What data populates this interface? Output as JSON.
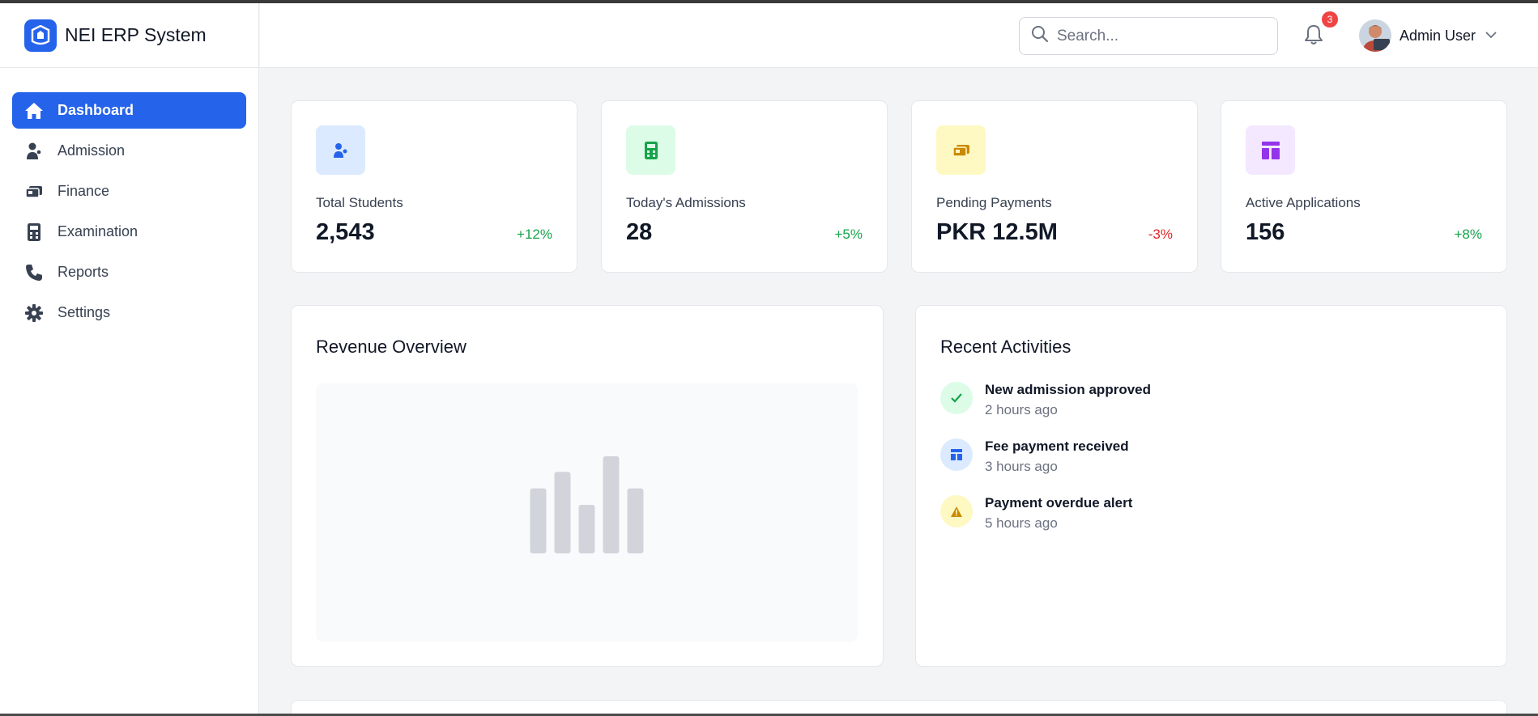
{
  "app": {
    "title": "NEI ERP System"
  },
  "sidebar": {
    "items": [
      {
        "label": "Dashboard",
        "icon": "home-icon",
        "active": true
      },
      {
        "label": "Admission",
        "icon": "user-tie-icon"
      },
      {
        "label": "Finance",
        "icon": "money-bill-icon"
      },
      {
        "label": "Examination",
        "icon": "calculator-icon"
      },
      {
        "label": "Reports",
        "icon": "phone-icon"
      },
      {
        "label": "Settings",
        "icon": "gear-icon"
      }
    ]
  },
  "header": {
    "search_placeholder": "Search...",
    "notification_count": "3",
    "user_name": "Admin User"
  },
  "stats": [
    {
      "label": "Total Students",
      "value": "2,543",
      "change": "+12%",
      "icon": "users-icon",
      "icon_bg": "#dbeafe",
      "icon_color": "#2563eb"
    },
    {
      "label": "Today's Admissions",
      "value": "28",
      "change": "+5%",
      "icon": "calculator-icon",
      "icon_bg": "#dcfce7",
      "icon_color": "#16a34a"
    },
    {
      "label": "Pending Payments",
      "value": "PKR 12.5M",
      "change": "-3%",
      "icon": "money-bill-icon",
      "icon_bg": "#fef9c3",
      "icon_color": "#ca8a04"
    },
    {
      "label": "Active Applications",
      "value": "156",
      "change": "+8%",
      "icon": "layout-icon",
      "icon_bg": "#f3e8ff",
      "icon_color": "#9333ea"
    }
  ],
  "revenue": {
    "title": "Revenue Overview"
  },
  "chart_data": {
    "type": "bar",
    "categories": [
      "",
      "",
      "",
      "",
      ""
    ],
    "values": [
      0.67,
      0.84,
      0.5,
      1.0,
      0.67
    ],
    "title": "",
    "xlabel": "",
    "ylabel": "",
    "placeholder": true,
    "bar_color": "#d1d5db"
  },
  "activities": {
    "title": "Recent Activities",
    "items": [
      {
        "title": "New admission approved",
        "time": "2 hours ago",
        "icon": "check-icon",
        "bg": "#dcfce7",
        "color": "#16a34a"
      },
      {
        "title": "Fee payment received",
        "time": "3 hours ago",
        "icon": "layout-icon",
        "bg": "#dbeafe",
        "color": "#2563eb"
      },
      {
        "title": "Payment overdue alert",
        "time": "5 hours ago",
        "icon": "warning-icon",
        "bg": "#fef9c3",
        "color": "#ca8a04"
      }
    ]
  },
  "colors": {
    "accent": "#2563eb",
    "positive": "#16a34a",
    "negative": "#dc2626"
  }
}
